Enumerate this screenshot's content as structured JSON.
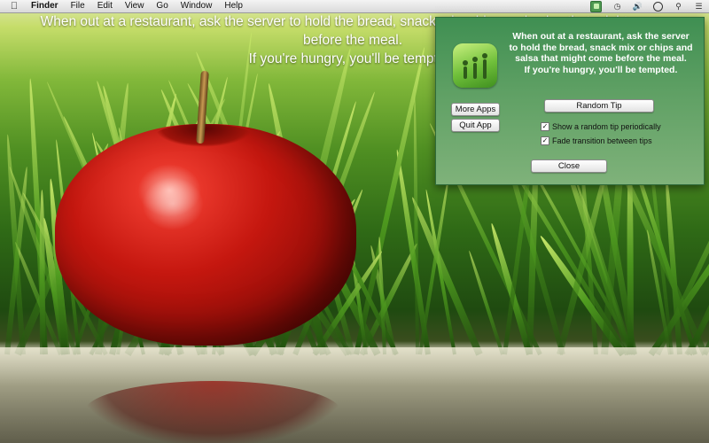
{
  "menubar": {
    "apple_icon": "apple-logo-icon",
    "items": [
      "Finder",
      "File",
      "Edit",
      "View",
      "Go",
      "Window",
      "Help"
    ],
    "tray_icons": [
      "app-tray-icon",
      "time-machine-icon",
      "volume-icon",
      "clock-icon",
      "spotlight-icon",
      "notification-center-icon"
    ]
  },
  "desktop_tip": {
    "line1": "When out at a restaurant, ask the server to hold the bread, snack mix, chips and salsa that might come",
    "line2": "before the meal.",
    "line3": "If you're hungry, you'll be tempted."
  },
  "panel": {
    "tip_lines": [
      "When out at a restaurant, ask the server",
      "to hold the bread, snack mix or chips and",
      "salsa that might come before the meal.",
      "If you're hungry, you'll be tempted."
    ],
    "more_apps_label": "More Apps",
    "quit_app_label": "Quit App",
    "random_tip_label": "Random Tip",
    "show_random_label": "Show a random tip periodically",
    "show_random_checked": true,
    "fade_label": "Fade transition between tips",
    "fade_checked": true,
    "close_label": "Close"
  },
  "colors": {
    "panel_top": "#3f8f52",
    "panel_bottom": "#7fb27a",
    "tray_active": "#4f9a52"
  }
}
